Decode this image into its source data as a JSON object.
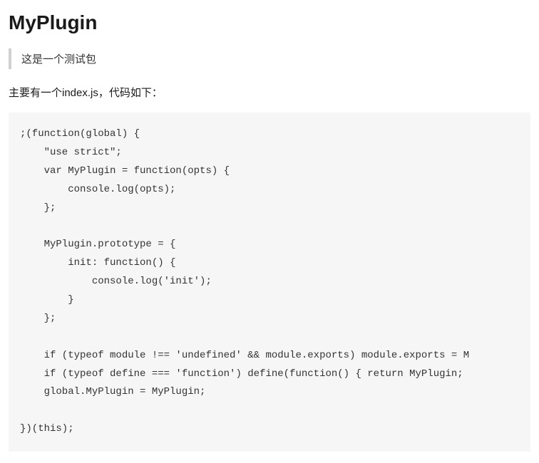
{
  "title": "MyPlugin",
  "blockquote": "这是一个测试包",
  "description": "主要有一个index.js，代码如下：",
  "code": ";(function(global) {\n    \"use strict\";\n    var MyPlugin = function(opts) {\n        console.log(opts);\n    };\n\n    MyPlugin.prototype = {\n        init: function() {\n            console.log('init');\n        }\n    };\n\n    if (typeof module !== 'undefined' && module.exports) module.exports = M\n    if (typeof define === 'function') define(function() { return MyPlugin;\n    global.MyPlugin = MyPlugin;\n\n})(this);"
}
